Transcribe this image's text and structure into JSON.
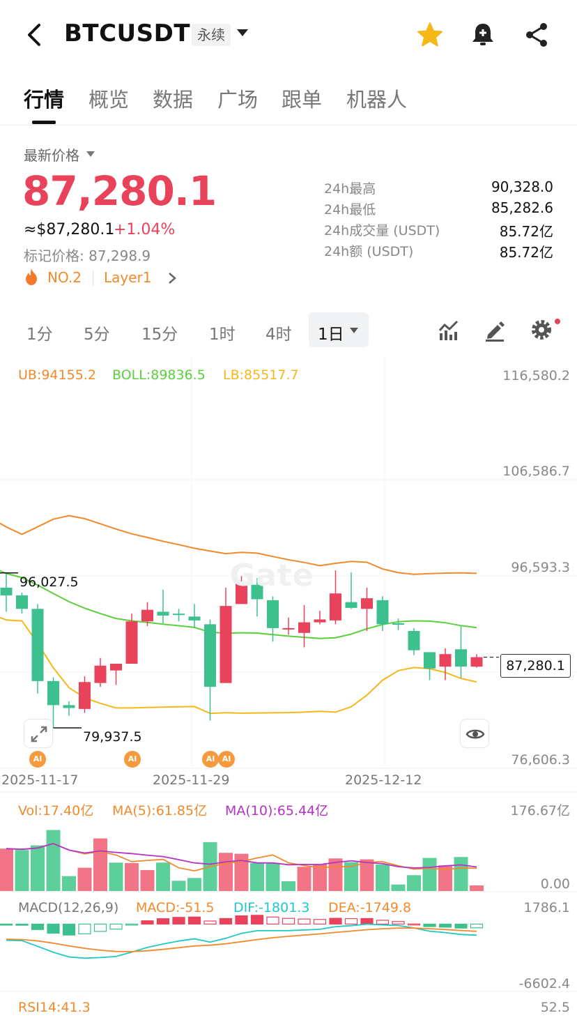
{
  "header": {
    "symbol": "BTCUSDT",
    "contract_type": "永续"
  },
  "tabs": [
    "行情",
    "概览",
    "数据",
    "广场",
    "跟单",
    "机器人"
  ],
  "price": {
    "latest_label": "最新价格",
    "last": "87,280.1",
    "usd_equiv": "≈$87,280.1",
    "change": "+1.04%",
    "mark_price": "标记价格: 87,298.9",
    "rank": "NO.2",
    "category": "Layer1"
  },
  "stats": [
    {
      "label": "24h最高",
      "value": "90,328.0"
    },
    {
      "label": "24h最低",
      "value": "85,282.6"
    },
    {
      "label": "24h成交量 (USDT)",
      "value": "85.72亿"
    },
    {
      "label": "24h额 (USDT)",
      "value": "85.72亿"
    }
  ],
  "intervals": [
    "1分",
    "5分",
    "15分",
    "1时",
    "4时",
    "1日"
  ],
  "active_interval": "1日",
  "colors": {
    "up": "#e8435a",
    "down": "#3cc08e",
    "accent": "#f08a2c",
    "ub": "#f08a2c",
    "boll": "#5ccf3c",
    "lb": "#f5b81b"
  },
  "indicators": {
    "boll": {
      "ub": "UB:94155.2",
      "boll": "BOLL:89836.5",
      "lb": "LB:85517.7"
    },
    "vol": {
      "vol": "Vol:17.40亿",
      "ma5": "MA(5):61.85亿",
      "ma10": "MA(10):65.44亿"
    },
    "macd": {
      "title": "MACD(12,26,9)",
      "macd": "MACD:-51.5",
      "dif": "DIF:-1801.3",
      "dea": "DEA:-1749.8"
    },
    "rsi": {
      "title": "RSI14:41.3"
    }
  },
  "axes": {
    "price_ticks": [
      "116,580.2",
      "106,586.7",
      "96,593.3",
      "76,606.3"
    ],
    "vol_ticks": [
      "176.67亿",
      "0.00"
    ],
    "macd_ticks": [
      "1786.1",
      "-6602.4"
    ],
    "rsi_ticks": [
      "52.5"
    ],
    "dates": [
      "2025-11-17",
      "2025-11-29",
      "2025-12-12"
    ]
  },
  "markers": {
    "current_price": "87,280.1",
    "high": "96,027.5",
    "low": "79,937.5",
    "ai": "AI"
  },
  "watermark": "Gate",
  "chart_data": {
    "type": "candlestick",
    "ylim": [
      76606.3,
      116580.2
    ],
    "candles": [
      {
        "o": 94500,
        "h": 96027,
        "l": 92000,
        "c": 93700
      },
      {
        "o": 93700,
        "h": 94000,
        "l": 91800,
        "c": 92300
      },
      {
        "o": 92300,
        "h": 92800,
        "l": 83500,
        "c": 84800
      },
      {
        "o": 84800,
        "h": 85200,
        "l": 79937,
        "c": 82300
      },
      {
        "o": 82300,
        "h": 82700,
        "l": 81200,
        "c": 82000
      },
      {
        "o": 81900,
        "h": 85300,
        "l": 81500,
        "c": 84700
      },
      {
        "o": 84600,
        "h": 87200,
        "l": 84200,
        "c": 86400
      },
      {
        "o": 85900,
        "h": 86500,
        "l": 84400,
        "c": 86600
      },
      {
        "o": 86600,
        "h": 91800,
        "l": 86600,
        "c": 91000
      },
      {
        "o": 91000,
        "h": 93000,
        "l": 90500,
        "c": 92200
      },
      {
        "o": 92000,
        "h": 94300,
        "l": 90800,
        "c": 91600
      },
      {
        "o": 91800,
        "h": 92300,
        "l": 91000,
        "c": 91700
      },
      {
        "o": 91500,
        "h": 92800,
        "l": 90300,
        "c": 91100
      },
      {
        "o": 90700,
        "h": 91200,
        "l": 80700,
        "c": 84200
      },
      {
        "o": 84600,
        "h": 94500,
        "l": 84600,
        "c": 92600
      },
      {
        "o": 92800,
        "h": 95700,
        "l": 92800,
        "c": 94900
      },
      {
        "o": 94800,
        "h": 95500,
        "l": 91500,
        "c": 93300
      },
      {
        "o": 93200,
        "h": 93600,
        "l": 88900,
        "c": 90300
      },
      {
        "o": 90300,
        "h": 91400,
        "l": 89600,
        "c": 90300
      },
      {
        "o": 89800,
        "h": 92700,
        "l": 88300,
        "c": 90900
      },
      {
        "o": 90900,
        "h": 92100,
        "l": 90700,
        "c": 91200
      },
      {
        "o": 91100,
        "h": 96300,
        "l": 90700,
        "c": 93900
      },
      {
        "o": 93000,
        "h": 96100,
        "l": 92300,
        "c": 92400
      },
      {
        "o": 92300,
        "h": 94500,
        "l": 90000,
        "c": 93400
      },
      {
        "o": 93200,
        "h": 93600,
        "l": 90000,
        "c": 90700
      },
      {
        "o": 90800,
        "h": 91300,
        "l": 90100,
        "c": 90700
      },
      {
        "o": 90000,
        "h": 90300,
        "l": 87500,
        "c": 88000
      },
      {
        "o": 87800,
        "h": 87800,
        "l": 84900,
        "c": 86100
      },
      {
        "o": 86300,
        "h": 88200,
        "l": 84900,
        "c": 87600
      },
      {
        "o": 88100,
        "h": 90500,
        "l": 85100,
        "c": 86300
      },
      {
        "o": 86300,
        "h": 87600,
        "l": 86200,
        "c": 87280
      }
    ],
    "volume": [
      {
        "v": 91,
        "up": true
      },
      {
        "v": 88,
        "up": false
      },
      {
        "v": 98,
        "up": false
      },
      {
        "v": 131,
        "up": false
      },
      {
        "v": 32,
        "up": false
      },
      {
        "v": 50,
        "up": true
      },
      {
        "v": 113,
        "up": true
      },
      {
        "v": 61,
        "up": false
      },
      {
        "v": 60,
        "up": true
      },
      {
        "v": 45,
        "up": true
      },
      {
        "v": 61,
        "up": false
      },
      {
        "v": 22,
        "up": false
      },
      {
        "v": 28,
        "up": false
      },
      {
        "v": 105,
        "up": false
      },
      {
        "v": 82,
        "up": true
      },
      {
        "v": 80,
        "up": true
      },
      {
        "v": 60,
        "up": false
      },
      {
        "v": 60,
        "up": false
      },
      {
        "v": 21,
        "up": false
      },
      {
        "v": 52,
        "up": true
      },
      {
        "v": 58,
        "up": true
      },
      {
        "v": 70,
        "up": true
      },
      {
        "v": 62,
        "up": false
      },
      {
        "v": 68,
        "up": true
      },
      {
        "v": 57,
        "up": false
      },
      {
        "v": 14,
        "up": false
      },
      {
        "v": 34,
        "up": false
      },
      {
        "v": 71,
        "up": false
      },
      {
        "v": 55,
        "up": true
      },
      {
        "v": 73,
        "up": false
      },
      {
        "v": 12,
        "up": true
      }
    ]
  }
}
